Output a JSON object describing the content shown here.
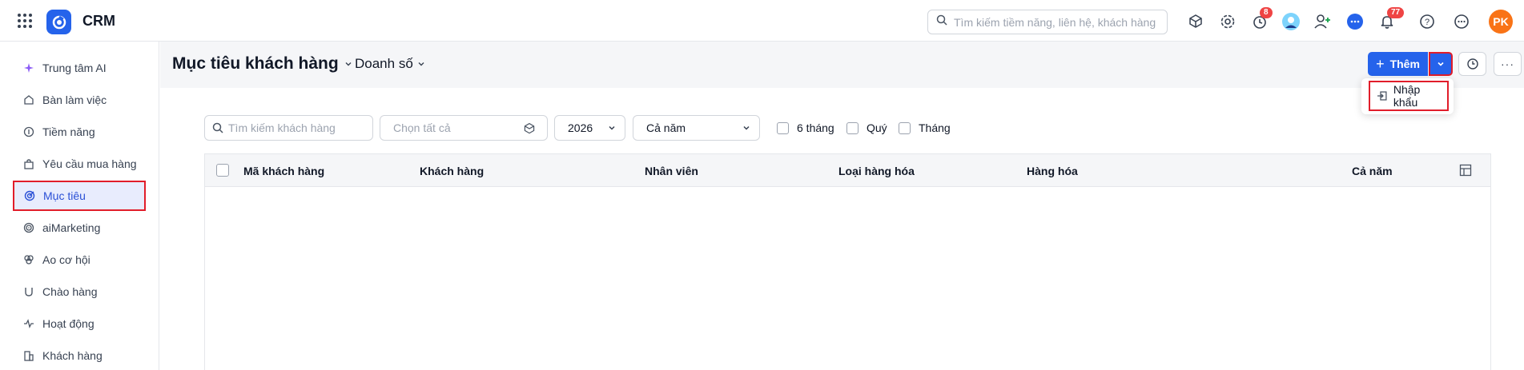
{
  "app": {
    "title": "CRM",
    "brand_color": "#2563eb"
  },
  "topbar": {
    "search_placeholder": "Tìm kiếm tiềm năng, liên hệ, khách hàng",
    "icons": [
      "apps-grid-icon",
      "crm-logo-icon",
      "search-icon",
      "package-search-icon",
      "settings-icon",
      "timer-icon",
      "user-profile-icon",
      "add-user-icon",
      "chat-icon",
      "bell-icon",
      "help-icon",
      "more-icon"
    ],
    "timer_badge": "8",
    "notification_badge": "77",
    "avatar_initials": "PK"
  },
  "sidebar": {
    "items": [
      {
        "label": "Trung tâm AI",
        "icon": "sparkle-icon"
      },
      {
        "label": "Bàn làm việc",
        "icon": "home-icon"
      },
      {
        "label": "Tiềm năng",
        "icon": "coin-icon"
      },
      {
        "label": "Yêu cầu mua hàng",
        "icon": "bag-icon"
      },
      {
        "label": "Mục tiêu",
        "icon": "target-icon",
        "active": true
      },
      {
        "label": "aiMarketing",
        "icon": "radar-icon"
      },
      {
        "label": "Ao cơ hội",
        "icon": "pool-icon"
      },
      {
        "label": "Chào hàng",
        "icon": "magnet-icon"
      },
      {
        "label": "Hoạt động",
        "icon": "activity-icon"
      },
      {
        "label": "Khách hàng",
        "icon": "building-icon"
      }
    ]
  },
  "header": {
    "title": "Mục tiêu khách hàng",
    "subview": "Doanh số",
    "add_label": "Thêm",
    "dropdown_item": "Nhập khẩu"
  },
  "filters": {
    "search_placeholder": "Tìm kiếm khách hàng",
    "select_all_placeholder": "Chọn tất cả",
    "year": "2026",
    "period": "Cả năm",
    "checkboxes": [
      "6 tháng",
      "Quý",
      "Tháng"
    ]
  },
  "table": {
    "columns": [
      "Mã khách hàng",
      "Khách hàng",
      "Nhân viên",
      "Loại hàng hóa",
      "Hàng hóa",
      "Cả năm"
    ],
    "rows": []
  }
}
